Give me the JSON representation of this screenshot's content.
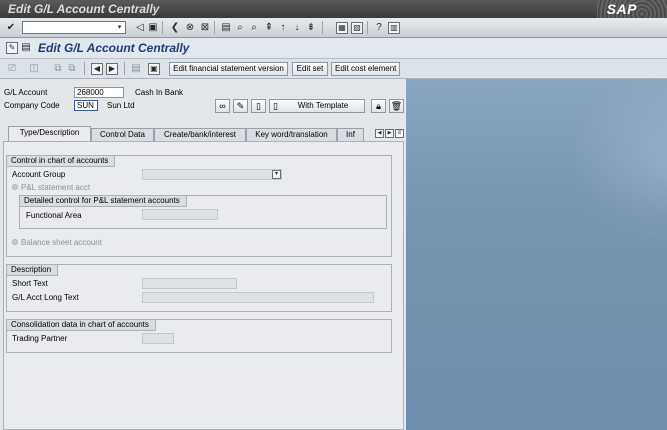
{
  "window": {
    "title": "Edit G/L Account Centrally",
    "logo_text": "SAP"
  },
  "app_title": "Edit G/L Account Centrally",
  "app_toolbar": {
    "edit_fin_stmt_version": "Edit financial statement version",
    "edit_set": "Edit set",
    "edit_cost_element": "Edit cost element"
  },
  "header": {
    "gl_account_label": "G/L Account",
    "gl_account_value": "268000",
    "gl_account_desc": "Cash In Bank",
    "company_code_label": "Company Code",
    "company_code_value": "SUN",
    "company_code_desc": "Sun Ltd",
    "with_template_label": "With Template"
  },
  "tabs": [
    {
      "label": "Type/Description",
      "active": true
    },
    {
      "label": "Control Data",
      "active": false
    },
    {
      "label": "Create/bank/interest",
      "active": false
    },
    {
      "label": "Key word/translation",
      "active": false
    },
    {
      "label": "Inf",
      "active": false
    }
  ],
  "control_group": {
    "title": "Control in chart of accounts",
    "account_group_label": "Account Group",
    "account_group_value": "",
    "pl_statement_label": "P&L statement acct",
    "detailed_title": "Detailed control for P&L statement accounts",
    "functional_area_label": "Functional Area",
    "functional_area_value": "",
    "balance_sheet_label": "Balance sheet account"
  },
  "description_group": {
    "title": "Description",
    "short_text_label": "Short Text",
    "short_text_value": "",
    "long_text_label": "G/L Acct Long Text",
    "long_text_value": ""
  },
  "consolidation_group": {
    "title": "Consolidation data in chart of accounts",
    "trading_partner_label": "Trading Partner",
    "trading_partner_value": ""
  },
  "colors": {
    "title_text": "#1d3b77",
    "right_pane": "#7693b1",
    "panel_bg": "#e9ebee"
  }
}
